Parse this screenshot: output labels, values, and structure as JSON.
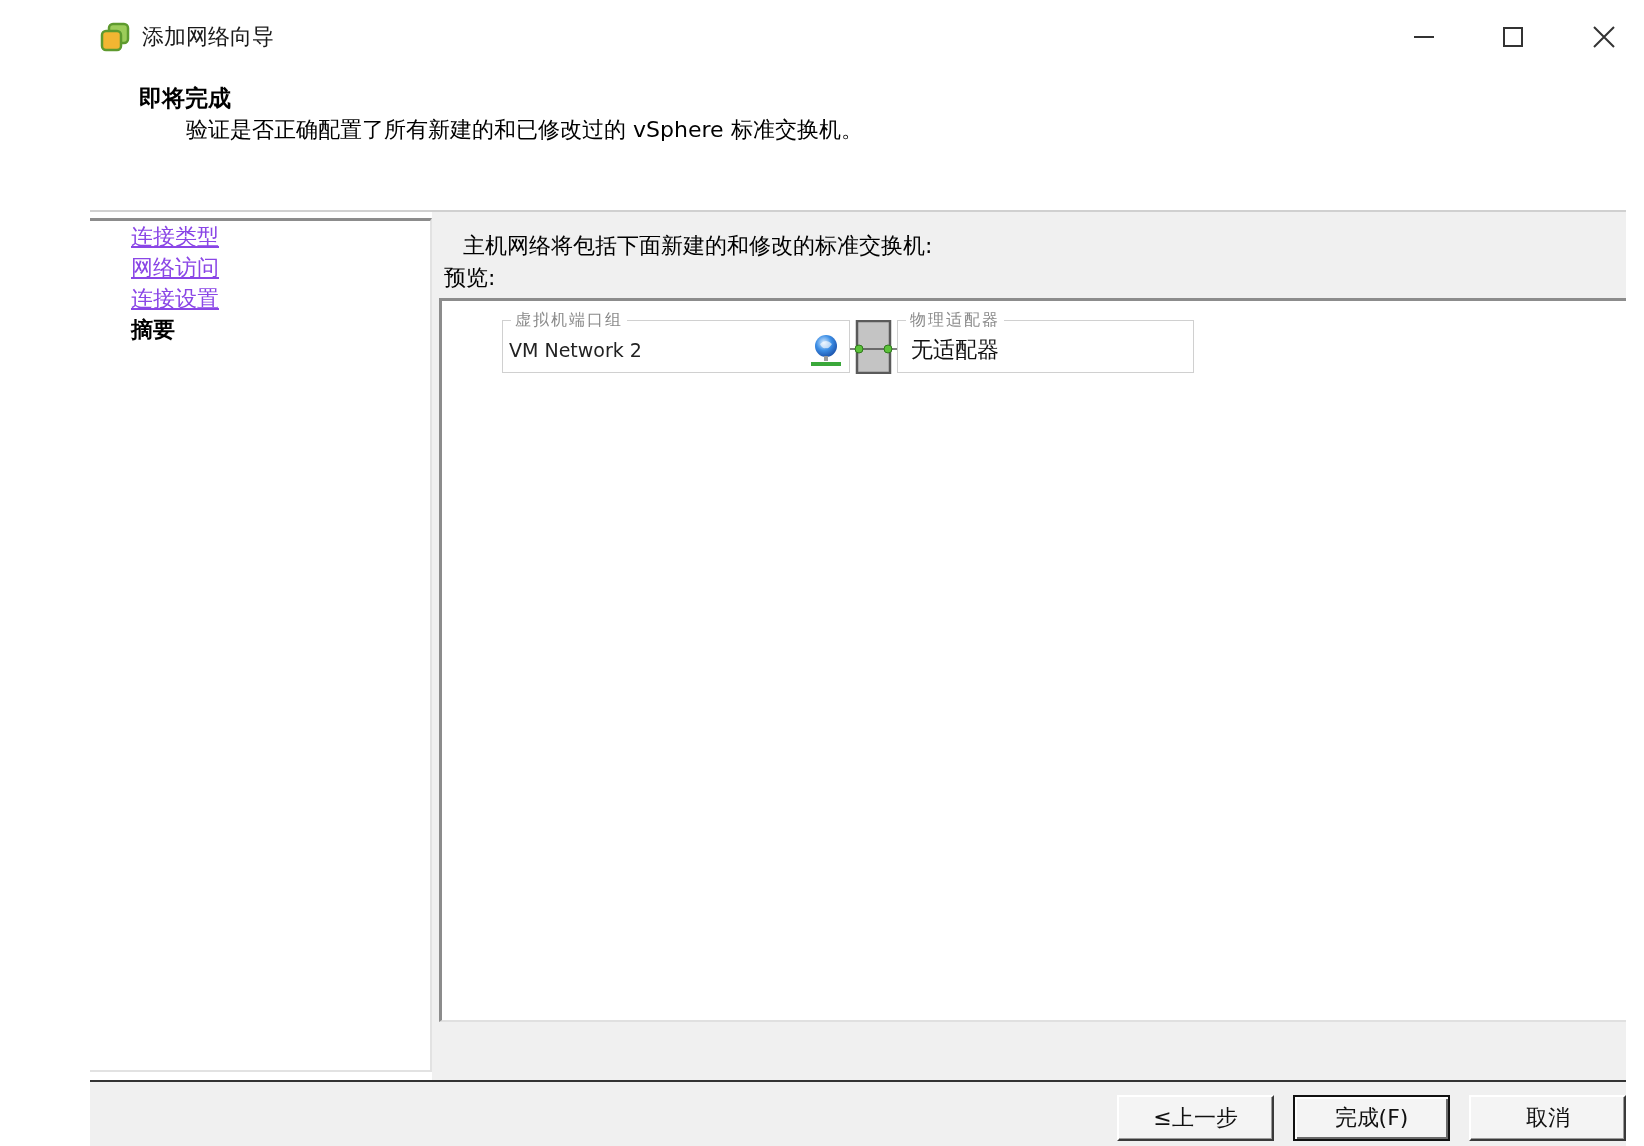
{
  "window": {
    "title": "添加网络向导"
  },
  "header": {
    "title": "即将完成",
    "description": "验证是否正确配置了所有新建的和已修改过的 vSphere 标准交换机。"
  },
  "steps": [
    {
      "label": "连接类型",
      "selected": false
    },
    {
      "label": "网络访问",
      "selected": false
    },
    {
      "label": "连接设置",
      "selected": false
    },
    {
      "label": "摘要",
      "selected": true
    }
  ],
  "summary": {
    "intro": "主机网络将包括下面新建的和修改的标准交换机:",
    "preview_label": "预览:",
    "port_group": {
      "legend": "虚拟机端口组",
      "name": "VM Network 2"
    },
    "adapters": {
      "legend": "物理适配器",
      "value": "无适配器"
    }
  },
  "buttons": [
    {
      "label": "≤上一步",
      "default": false
    },
    {
      "label": "完成(F)",
      "default": true
    },
    {
      "label": "取消",
      "default": false
    }
  ]
}
